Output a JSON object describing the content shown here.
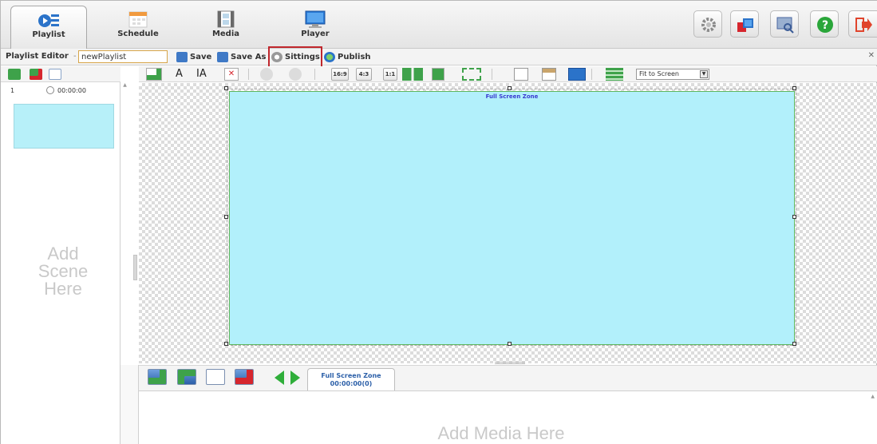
{
  "nav": {
    "tabs": [
      {
        "label": "Playlist",
        "icon": "playlist-icon",
        "active": true
      },
      {
        "label": "Schedule",
        "icon": "calendar-icon"
      },
      {
        "label": "Media",
        "icon": "film-icon"
      },
      {
        "label": "Player",
        "icon": "monitor-icon"
      }
    ],
    "right_buttons": [
      {
        "icon": "gear-icon"
      },
      {
        "icon": "windows-icon"
      },
      {
        "icon": "screen-search-icon"
      },
      {
        "icon": "help-icon",
        "glyph": "?"
      },
      {
        "icon": "logout-icon"
      }
    ]
  },
  "editor": {
    "title": "Playlist Editor",
    "separator": "-",
    "playlist_name": "newPlaylist",
    "save_label": "Save",
    "save_as_label": "Save As",
    "settings_label": "Sittings",
    "publish_label": "Publish"
  },
  "toolbar": {
    "ratio_169": "16:9",
    "ratio_43": "4:3",
    "ratio_11": "1:1",
    "fit_select": "Fit to Screen"
  },
  "scenes": {
    "items": [
      {
        "number": "1",
        "time": "00:00:00"
      }
    ],
    "add_scene_line1": "Add",
    "add_scene_line2": "Scene",
    "add_scene_line3": "Here"
  },
  "canvas": {
    "zone_title": "Full Screen Zone"
  },
  "media": {
    "zone_tab_name": "Full Screen Zone",
    "zone_tab_time": "00:00:00(0)",
    "add_media": "Add Media Here"
  },
  "colors": {
    "zone_fill": "#b2f0fb",
    "highlight": "#c0272d",
    "accent_green": "#2fae3a"
  }
}
